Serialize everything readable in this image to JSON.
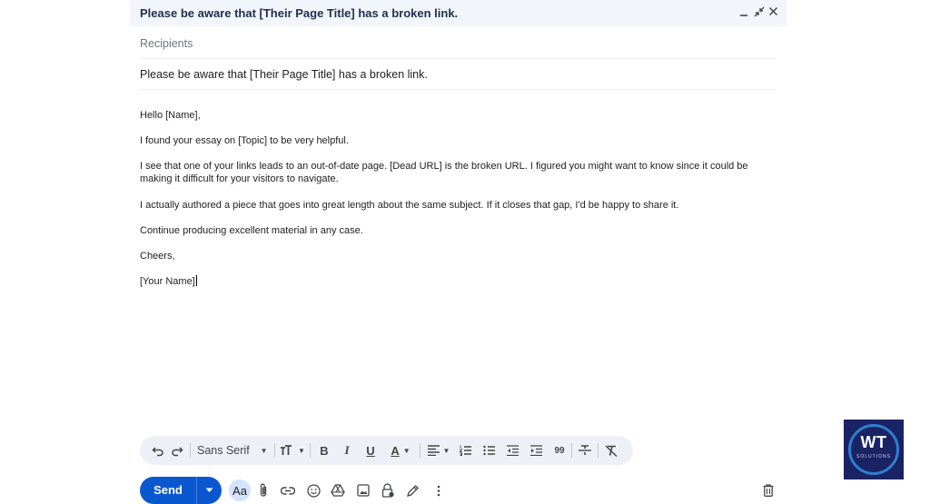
{
  "compose": {
    "window_title": "Please be aware that [Their Page Title] has a broken link.",
    "recipients_placeholder": "Recipients",
    "subject": "Please be aware that [Their Page Title] has a broken link.",
    "body": {
      "greeting": "Hello [Name],",
      "para1": "I found your essay on [Topic] to be very helpful.",
      "para2": "I see that one of your links leads to an out-of-date page. [Dead URL] is the broken URL. I figured you might want to know since it could be making it difficult for your visitors to navigate.",
      "para3": "I actually authored a piece that goes into great length about the same subject. If it closes that gap, I'd be happy to share it.",
      "para4": "Continue producing excellent material in any case.",
      "closing": "Cheers,",
      "signature": "[Your Name]"
    }
  },
  "window_controls": {
    "minimize": "minimize-icon",
    "exit_fullscreen": "exit-fullscreen-icon",
    "close": "close-icon"
  },
  "toolbar": {
    "font_family": "Sans Serif",
    "icons": [
      "undo-icon",
      "redo-icon",
      "font-size-icon",
      "bold-icon",
      "italic-icon",
      "underline-icon",
      "text-color-icon",
      "align-icon",
      "numbered-list-icon",
      "bulleted-list-icon",
      "indent-less-icon",
      "indent-more-icon",
      "quote-icon",
      "strikethrough-icon",
      "remove-formatting-icon"
    ],
    "bold_label": "B",
    "italic_label": "I",
    "underline_label": "U",
    "text_color_label": "A",
    "quote_label": "99"
  },
  "bottom_bar": {
    "send_label": "Send",
    "formatting_label": "Aa",
    "icons": [
      "attach-icon",
      "link-icon",
      "emoji-icon",
      "drive-icon",
      "photo-icon",
      "confidential-lock-icon",
      "signature-pen-icon",
      "more-options-icon",
      "trash-icon"
    ]
  },
  "logo": {
    "text": "WT",
    "subtext": "SOLUTIONS"
  },
  "colors": {
    "send_button": "#0b57d0",
    "titlebar_bg": "#f2f6fc",
    "toolbar_bg": "#edf1f7",
    "logo_bg": "#1a2363"
  }
}
